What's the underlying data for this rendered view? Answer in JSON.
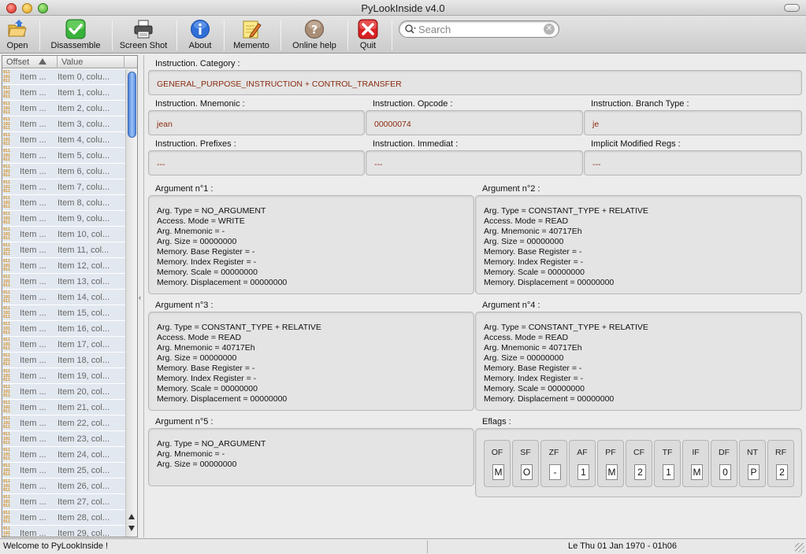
{
  "window": {
    "title": "PyLookInside v4.0"
  },
  "toolbar": {
    "open": "Open",
    "disassemble": "Disassemble",
    "screenshot": "Screen Shot",
    "about": "About",
    "memento": "Memento",
    "online_help": "Online help",
    "quit": "Quit",
    "search_placeholder": "Search"
  },
  "list": {
    "col_offset": "Offset",
    "col_value": "Value",
    "rows": [
      {
        "offset": "Item ...",
        "value": "Item 0, colu..."
      },
      {
        "offset": "Item ...",
        "value": "Item 1, colu..."
      },
      {
        "offset": "Item ...",
        "value": "Item 2, colu..."
      },
      {
        "offset": "Item ...",
        "value": "Item 3, colu..."
      },
      {
        "offset": "Item ...",
        "value": "Item 4, colu..."
      },
      {
        "offset": "Item ...",
        "value": "Item 5, colu..."
      },
      {
        "offset": "Item ...",
        "value": "Item 6, colu..."
      },
      {
        "offset": "Item ...",
        "value": "Item 7, colu..."
      },
      {
        "offset": "Item ...",
        "value": "Item 8, colu..."
      },
      {
        "offset": "Item ...",
        "value": "Item 9, colu..."
      },
      {
        "offset": "Item ...",
        "value": "Item 10, col..."
      },
      {
        "offset": "Item ...",
        "value": "Item 11, col..."
      },
      {
        "offset": "Item ...",
        "value": "Item 12, col..."
      },
      {
        "offset": "Item ...",
        "value": "Item 13, col..."
      },
      {
        "offset": "Item ...",
        "value": "Item 14, col..."
      },
      {
        "offset": "Item ...",
        "value": "Item 15, col..."
      },
      {
        "offset": "Item ...",
        "value": "Item 16, col..."
      },
      {
        "offset": "Item ...",
        "value": "Item 17, col..."
      },
      {
        "offset": "Item ...",
        "value": "Item 18, col..."
      },
      {
        "offset": "Item ...",
        "value": "Item 19, col..."
      },
      {
        "offset": "Item ...",
        "value": "Item 20, col..."
      },
      {
        "offset": "Item ...",
        "value": "Item 21, col..."
      },
      {
        "offset": "Item ...",
        "value": "Item 22, col..."
      },
      {
        "offset": "Item ...",
        "value": "Item 23, col..."
      },
      {
        "offset": "Item ...",
        "value": "Item 24, col..."
      },
      {
        "offset": "Item ...",
        "value": "Item 25, col..."
      },
      {
        "offset": "Item ...",
        "value": "Item 26, col..."
      },
      {
        "offset": "Item ...",
        "value": "Item 27, col..."
      },
      {
        "offset": "Item ...",
        "value": "Item 28, col..."
      },
      {
        "offset": "Item ...",
        "value": "Item 29, col..."
      }
    ]
  },
  "instruction": {
    "category_label": "Instruction. Category :",
    "category_value": "GENERAL_PURPOSE_INSTRUCTION + CONTROL_TRANSFER",
    "mnemonic_label": "Instruction. Mnemonic :",
    "mnemonic_value": "jean",
    "opcode_label": "Instruction. Opcode :",
    "opcode_value": "00000074",
    "branch_label": "Instruction. Branch Type :",
    "branch_value": "je",
    "prefixes_label": "Instruction. Prefixes :",
    "prefixes_value": "---",
    "immediat_label": "Instruction. Immediat :",
    "immediat_value": "---",
    "implicit_label": "Implicit Modified Regs :",
    "implicit_value": "---"
  },
  "arguments": [
    {
      "label": "Argument n°1 :",
      "lines": [
        "Arg. Type = NO_ARGUMENT",
        "Access. Mode = WRITE",
        "Arg. Mnemonic = -",
        "Arg. Size = 00000000",
        "Memory. Base Register = -",
        "Memory. Index Register = -",
        "Memory. Scale = 00000000",
        "Memory. Displacement = 00000000"
      ]
    },
    {
      "label": "Argument n°2 :",
      "lines": [
        "Arg. Type = CONSTANT_TYPE + RELATIVE",
        "Access. Mode = READ",
        "Arg. Mnemonic = 40717Eh",
        "Arg. Size = 00000000",
        "Memory. Base Register = -",
        "Memory. Index Register = -",
        "Memory. Scale = 00000000",
        "Memory. Displacement = 00000000"
      ]
    },
    {
      "label": "Argument n°3 :",
      "lines": [
        "Arg. Type = CONSTANT_TYPE + RELATIVE",
        "Access. Mode = READ",
        "Arg. Mnemonic = 40717Eh",
        "Arg. Size = 00000000",
        "Memory. Base Register = -",
        "Memory. Index Register = -",
        "Memory. Scale = 00000000",
        "Memory. Displacement = 00000000"
      ]
    },
    {
      "label": "Argument n°4 :",
      "lines": [
        "Arg. Type = CONSTANT_TYPE + RELATIVE",
        "Access. Mode = READ",
        "Arg. Mnemonic = 40717Eh",
        "Arg. Size = 00000000",
        "Memory. Base Register = -",
        "Memory. Index Register = -",
        "Memory. Scale = 00000000",
        "Memory. Displacement = 00000000"
      ]
    },
    {
      "label": "Argument n°5 :",
      "lines": [
        "Arg. Type = NO_ARGUMENT",
        "Arg. Mnemonic = -",
        "Arg. Size = 00000000"
      ]
    }
  ],
  "eflags": {
    "label": "Eflags :",
    "flags": [
      {
        "name": "OF",
        "value": "M"
      },
      {
        "name": "SF",
        "value": "O"
      },
      {
        "name": "ZF",
        "value": "-"
      },
      {
        "name": "AF",
        "value": "1"
      },
      {
        "name": "PF",
        "value": "M"
      },
      {
        "name": "CF",
        "value": "2"
      },
      {
        "name": "TF",
        "value": "1"
      },
      {
        "name": "IF",
        "value": "M"
      },
      {
        "name": "DF",
        "value": "0"
      },
      {
        "name": "NT",
        "value": "P"
      },
      {
        "name": "RF",
        "value": "2"
      }
    ]
  },
  "status": {
    "left": "Welcome to PyLookInside !",
    "right": "Le Thu 01 Jan 1970 - 01h06"
  },
  "colors": {
    "value_text": "#8a2b10",
    "list_row": "#e2e8ef",
    "binary_icon": "#d38b1c"
  }
}
